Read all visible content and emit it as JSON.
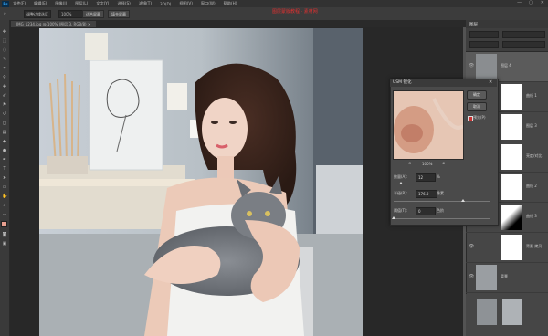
{
  "menu": {
    "logo": "Ps",
    "items": [
      "文件(F)",
      "编辑(E)",
      "图像(I)",
      "图层(L)",
      "文字(Y)",
      "选择(S)",
      "滤镜(T)",
      "3D(D)",
      "视图(V)",
      "窗口(W)",
      "帮助(H)"
    ],
    "window_controls": [
      "—",
      "▢",
      "✕"
    ]
  },
  "options": {
    "field1": "调整边缘选区",
    "zoom": "100%",
    "btn_fit": "适合屏幕",
    "btn_fill": "填充屏幕"
  },
  "watermark": "图层蒙版教程 · 素材网",
  "tab": {
    "label": "IMG_1234.jpg @ 100% (图层 3, RGB/8) ×"
  },
  "panel": {
    "title": "图层",
    "layers": [
      {
        "name": "图层 4",
        "type": "photo"
      },
      {
        "name": "曲线 1",
        "type": "white"
      },
      {
        "name": "图层 3",
        "type": "white"
      },
      {
        "name": "亮度/对比",
        "type": "white"
      },
      {
        "name": "曲线 2",
        "type": "white"
      },
      {
        "name": "曲线 3",
        "type": "gradient"
      },
      {
        "name": "背景 拷贝",
        "type": "white"
      },
      {
        "name": "背景",
        "type": "photo"
      }
    ]
  },
  "dialog": {
    "title": "USM 锐化",
    "ok": "确定",
    "cancel": "取消",
    "preview": "预览(P)",
    "zoom": "100%",
    "amount_label": "数量(A):",
    "amount_value": "12",
    "amount_unit": "%",
    "radius_label": "半径(R):",
    "radius_value": "176.0",
    "radius_unit": "像素",
    "threshold_label": "阈值(T):",
    "threshold_value": "0",
    "threshold_unit": "色阶",
    "amount_level": 0.08,
    "radius_level": 0.72,
    "threshold_level": 0.0
  },
  "colors": {
    "accent": "#31a8ff",
    "panel_bg": "#464646",
    "canvas_bg": "#282828"
  }
}
